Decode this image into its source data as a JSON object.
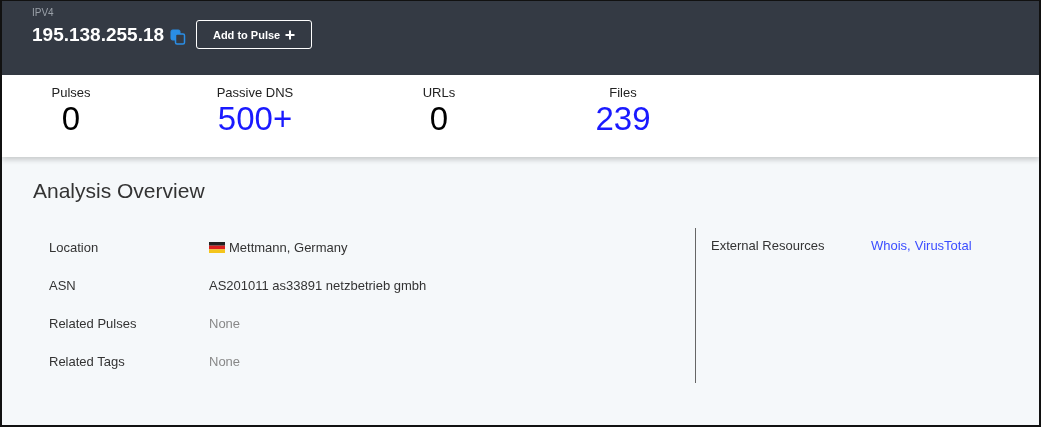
{
  "header": {
    "type_label": "IPV4",
    "ip": "195.138.255.18",
    "add_button": "Add to Pulse"
  },
  "stats": [
    {
      "label": "Pulses",
      "value": "0",
      "link": false
    },
    {
      "label": "Passive DNS",
      "value": "500+",
      "link": true
    },
    {
      "label": "URLs",
      "value": "0",
      "link": false
    },
    {
      "label": "Files",
      "value": "239",
      "link": true
    }
  ],
  "overview": {
    "title": "Analysis Overview",
    "details": [
      {
        "label": "Location",
        "value": "Mettmann, Germany",
        "kind": "location"
      },
      {
        "label": "ASN",
        "value": "AS201011 as33891 netzbetrieb gmbh",
        "kind": "text"
      },
      {
        "label": "Related Pulses",
        "value": "None",
        "kind": "empty"
      },
      {
        "label": "Related Tags",
        "value": "None",
        "kind": "empty"
      }
    ],
    "external": {
      "label": "External Resources",
      "links": [
        "Whois,",
        "VirusTotal"
      ]
    }
  }
}
